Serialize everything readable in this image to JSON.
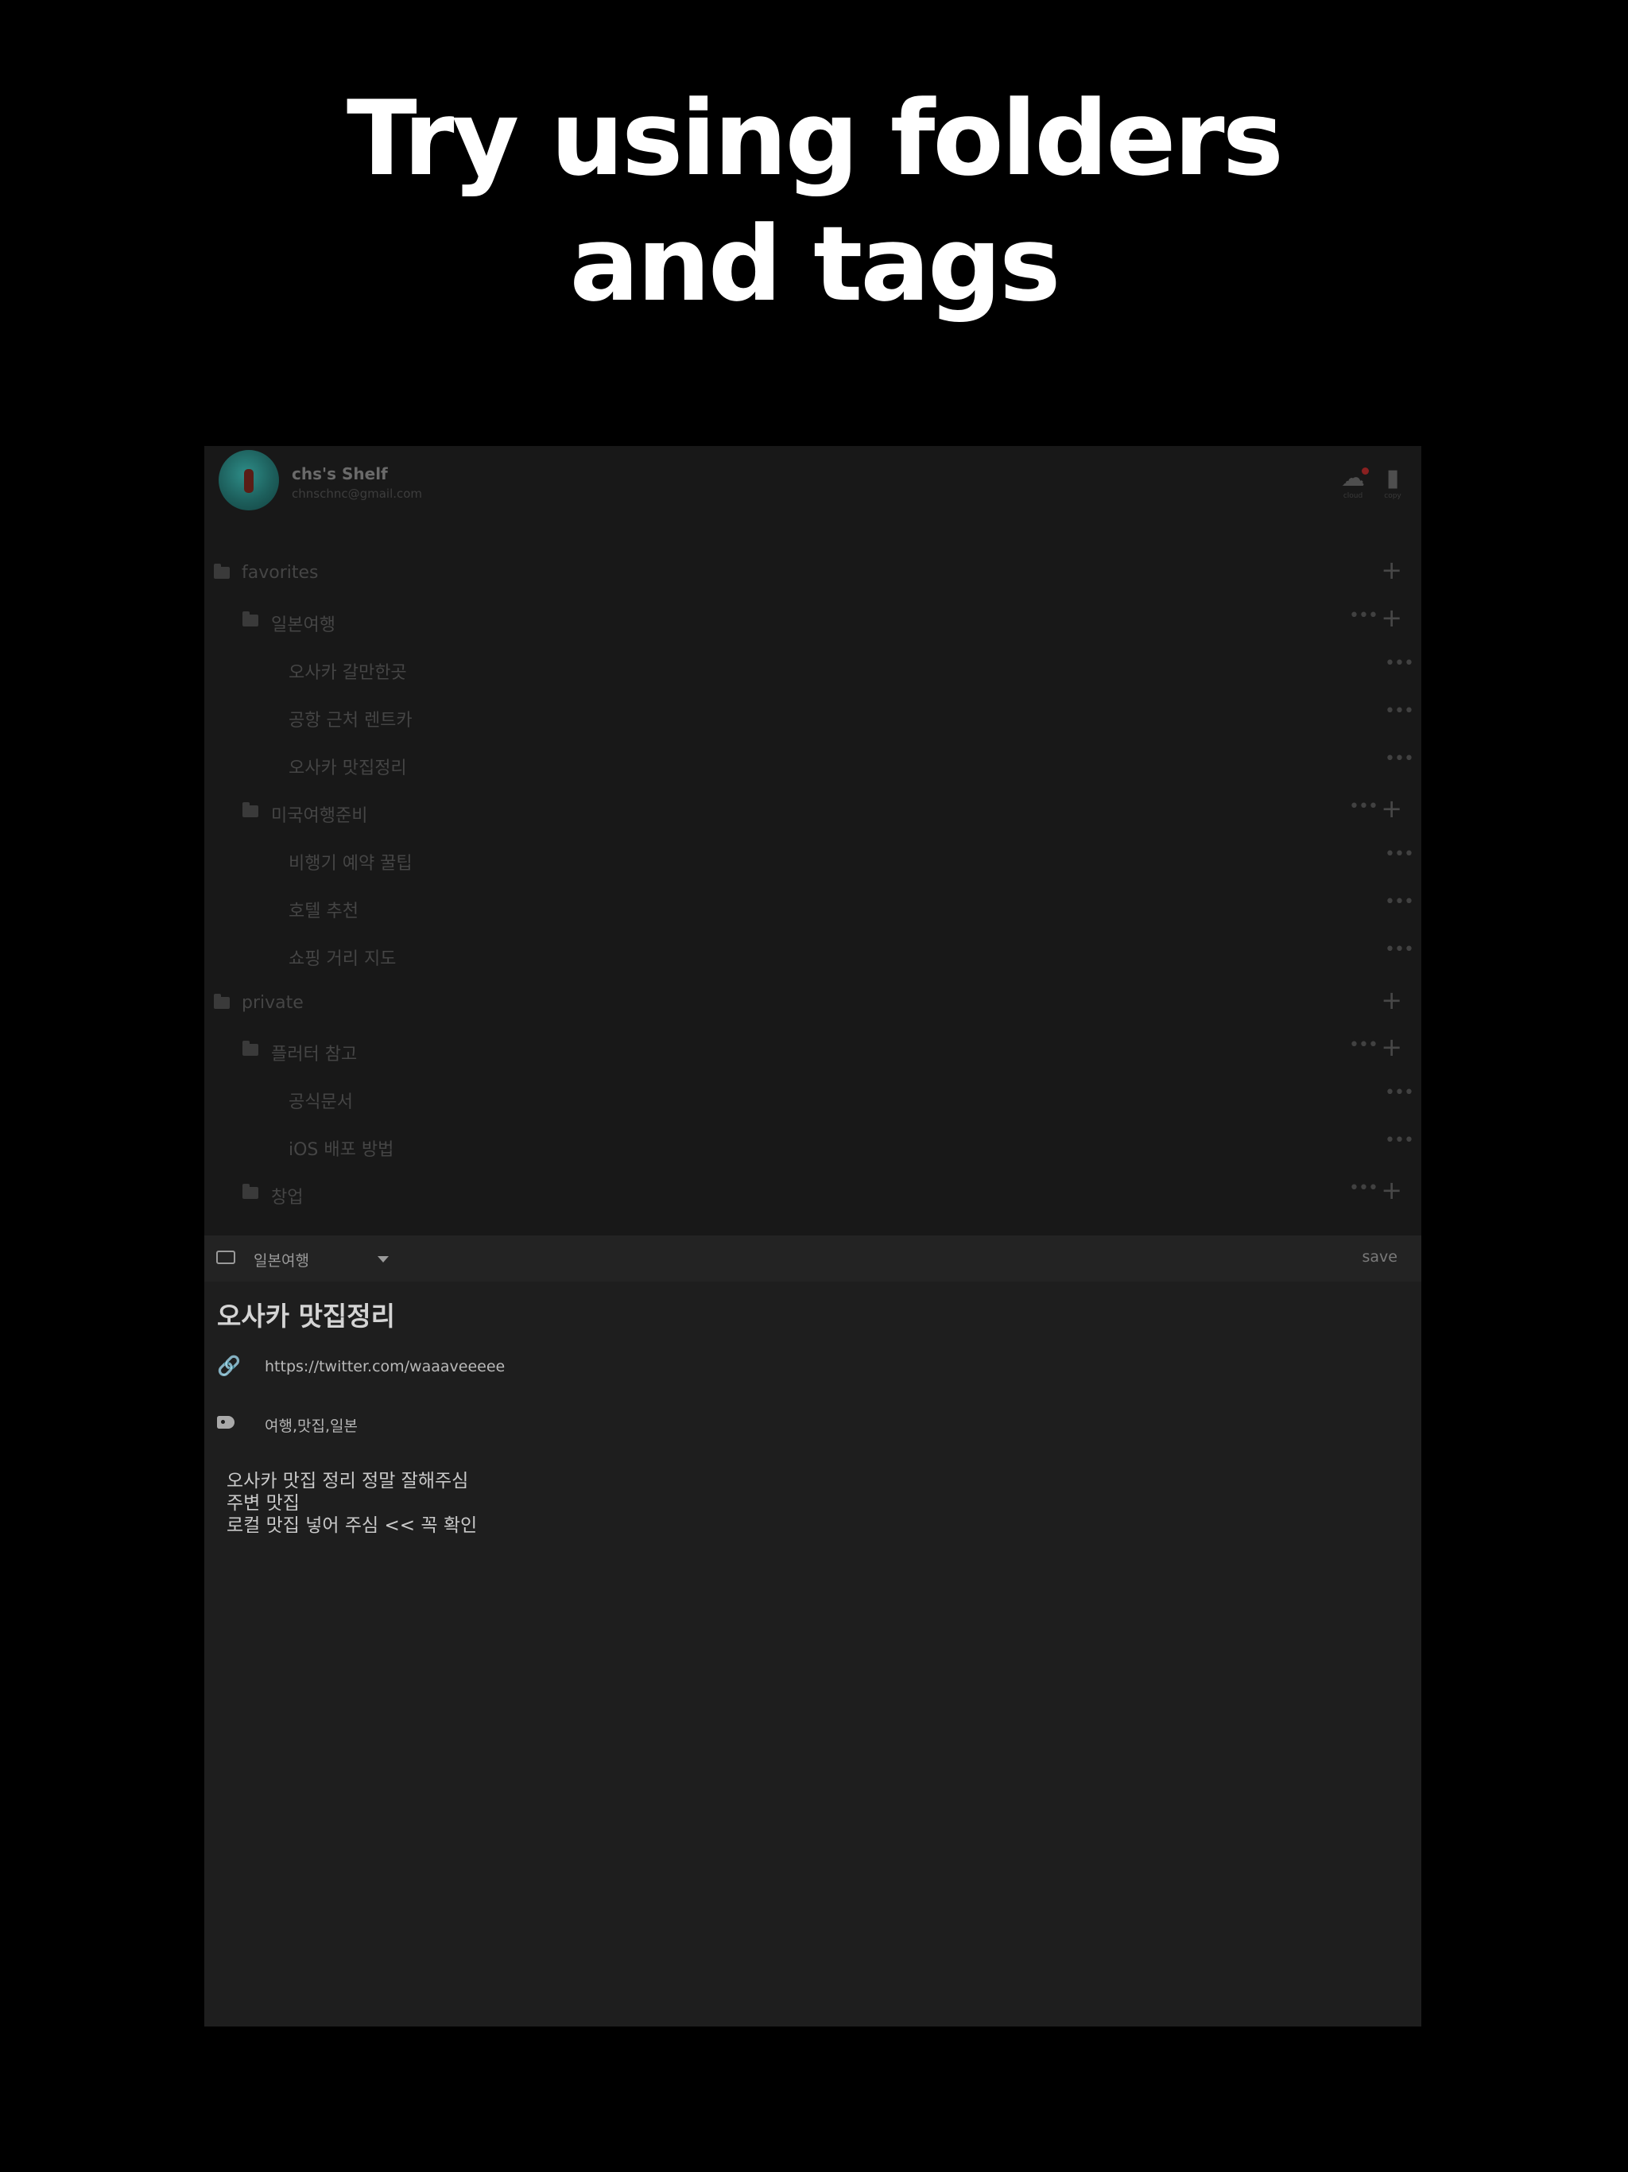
{
  "headline": {
    "line1": "Try using folders",
    "line2": "and tags"
  },
  "profile": {
    "name": "chs's Shelf",
    "email": "chnschnc@gmail.com"
  },
  "top_icons": {
    "cloud_caption": "cloud",
    "copy_caption": "copy"
  },
  "tree": {
    "favorites": {
      "label": "favorites",
      "japan": {
        "label": "일본여행",
        "items": [
          "오사카 갈만한곳",
          "공항 근처 렌트카",
          "오사카 맛집정리"
        ]
      },
      "usa": {
        "label": "미국여행준비",
        "items": [
          "비행기 예약 꿀팁",
          "호텔 추천",
          "쇼핑 거리 지도"
        ]
      }
    },
    "private": {
      "label": "private",
      "flutter": {
        "label": "플러터 참고",
        "items": [
          "공식문서",
          "iOS 배포 방법"
        ]
      },
      "startup": {
        "label": "창업"
      }
    }
  },
  "editor": {
    "folder": "일본여행",
    "save_label": "save",
    "title": "오사카 맛집정리",
    "url": "https://twitter.com/waaaveeeee",
    "tags": "여행,맛집,일본",
    "body": [
      "오사카 맛집 정리 정말 잘해주심",
      "주변 맛집",
      "로컬 맛집 넣어 주심 << 꼭 확인"
    ]
  },
  "glyphs": {
    "dots": "•••",
    "plus": "+",
    "link": "🔗"
  },
  "colors": {
    "background": "#000000",
    "headline": "#ffffff",
    "panel": "#1e1e1e",
    "sidebar": "#181818"
  }
}
